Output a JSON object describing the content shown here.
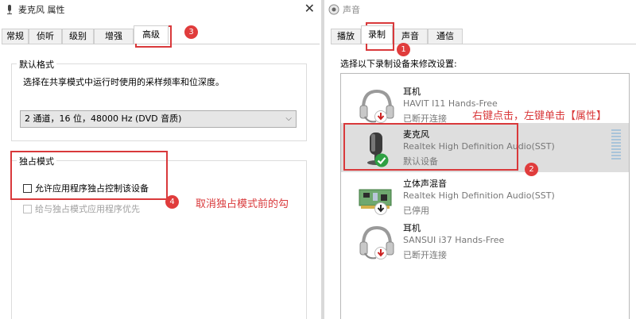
{
  "left_window": {
    "title": "麦克风 属性",
    "close_symbol": "✕",
    "tabs": [
      "常规",
      "侦听",
      "级别",
      "增强",
      "高级"
    ],
    "active_tab": "高级",
    "default_format": {
      "legend": "默认格式",
      "description": "选择在共享模式中运行时使用的采样频率和位深度。",
      "selected": "2 通道，16 位，48000 Hz (DVD 音质)"
    },
    "exclusive_mode": {
      "legend": "独占模式",
      "allow_label": "允许应用程序独占控制该设备",
      "priority_label": "给与独占模式应用程序优先"
    },
    "annotation": "取消独占模式前的勾"
  },
  "right_window": {
    "title": "声音",
    "tabs": [
      "播放",
      "录制",
      "声音",
      "通信"
    ],
    "active_tab": "录制",
    "instruction": "选择以下录制设备来修改设置:",
    "annotation": "右键点击，左键单击【属性】",
    "devices": [
      {
        "name": "耳机",
        "desc": "HAVIT I11 Hands-Free",
        "status": "已断开连接",
        "icon": "headset-icon",
        "badge": "red-down-arrow"
      },
      {
        "name": "麦克风",
        "desc": "Realtek High Definition Audio(SST)",
        "status": "默认设备",
        "icon": "microphone-icon",
        "badge": "green-check"
      },
      {
        "name": "立体声混音",
        "desc": "Realtek High Definition Audio(SST)",
        "status": "已停用",
        "icon": "circuit-board-icon",
        "badge": "black-down-arrow"
      },
      {
        "name": "耳机",
        "desc": "SANSUI i37 Hands-Free",
        "status": "已断开连接",
        "icon": "headset-icon",
        "badge": "red-down-arrow"
      }
    ]
  },
  "callouts": [
    "1",
    "2",
    "3",
    "4"
  ],
  "colors": {
    "annotation_red": "#d9393b",
    "badge_red": "#e03c3c",
    "selected_row": "#dedede",
    "check_green": "#2ea043"
  }
}
